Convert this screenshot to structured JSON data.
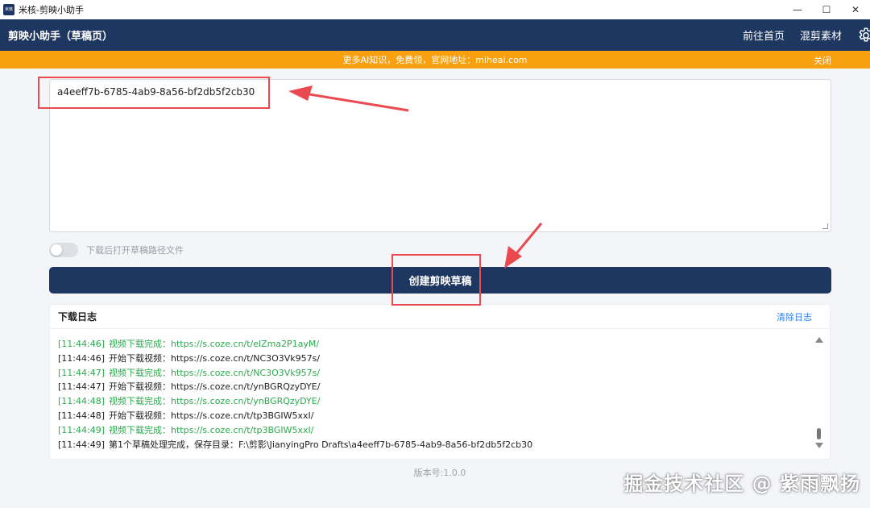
{
  "window": {
    "title": "米核-剪映小助手",
    "icon_text": "米核",
    "minimize_glyph": "—",
    "maximize_glyph": "☐",
    "close_glyph": "✕"
  },
  "header": {
    "title": "剪映小助手（草稿页）",
    "nav": [
      "前往首页",
      "混剪素材"
    ],
    "settings_icon": "gear-icon"
  },
  "banner": {
    "text": "更多AI知识，免费领，官网地址：miheai.com",
    "close_label": "关闭"
  },
  "draft_input": {
    "value": "a4eeff7b-6785-4ab9-8a56-bf2db5f2cb30"
  },
  "toggle": {
    "label": "下载后打开草稿路径文件",
    "state": "off"
  },
  "create_button": {
    "label": "创建剪映草稿"
  },
  "log": {
    "title": "下载日志",
    "clear_label": "清除日志",
    "lines": [
      {
        "time": "[11:44:46]",
        "message": "视频下载完成：https://s.coze.cn/t/elZma2P1ayM/",
        "color": "#2ca94e"
      },
      {
        "time": "[11:44:46]",
        "message": "开始下载视频：https://s.coze.cn/t/NC3O3Vk957s/",
        "color": "#222222"
      },
      {
        "time": "[11:44:47]",
        "message": "视频下载完成：https://s.coze.cn/t/NC3O3Vk957s/",
        "color": "#2ca94e"
      },
      {
        "time": "[11:44:47]",
        "message": "开始下载视频：https://s.coze.cn/t/ynBGRQzyDYE/",
        "color": "#222222"
      },
      {
        "time": "[11:44:48]",
        "message": "视频下载完成：https://s.coze.cn/t/ynBGRQzyDYE/",
        "color": "#2ca94e"
      },
      {
        "time": "[11:44:48]",
        "message": "开始下载视频：https://s.coze.cn/t/tp3BGIW5xxI/",
        "color": "#222222"
      },
      {
        "time": "[11:44:49]",
        "message": "视频下载完成：https://s.coze.cn/t/tp3BGIW5xxI/",
        "color": "#2ca94e"
      },
      {
        "time": "[11:44:49]",
        "message": "第1个草稿处理完成，保存目录：F:\\剪影\\JianyingPro Drafts\\a4eeff7b-6785-4ab9-8a56-bf2db5f2cb30",
        "color": "#222222"
      }
    ]
  },
  "footer": {
    "version": "版本号:1.0.0"
  },
  "watermark": "掘金技术社区 @ 紫雨飘扬",
  "colors": {
    "header_bg": "#1e3760",
    "banner_bg": "#f8a00f",
    "link_blue": "#2f7de1",
    "success_green": "#2ca94e",
    "annotation_red": "#ea4a4f"
  }
}
